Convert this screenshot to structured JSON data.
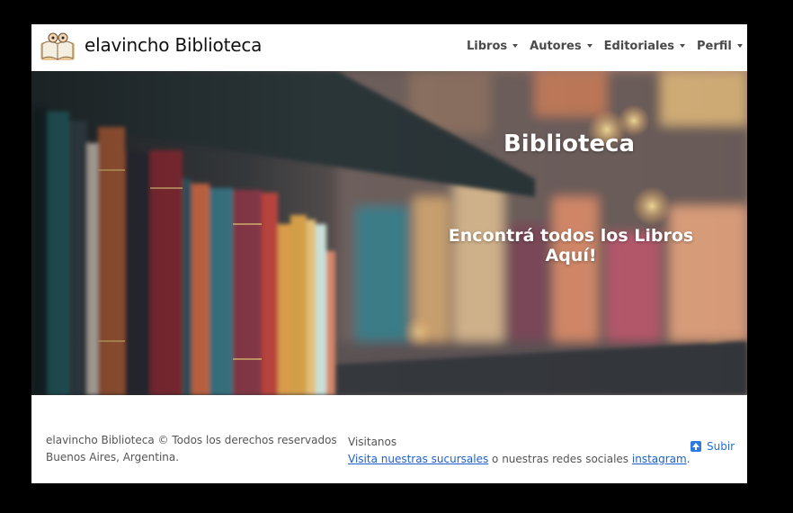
{
  "navbar": {
    "brand": "elavincho Biblioteca",
    "logo_icon": "open-book-logo-icon",
    "items": [
      {
        "label": "Libros"
      },
      {
        "label": "Autores"
      },
      {
        "label": "Editoriales"
      },
      {
        "label": "Perfil"
      }
    ]
  },
  "hero": {
    "title": "Biblioteca",
    "subtitle": "Encontrá todos los Libros Aquí!"
  },
  "footer": {
    "copyright": "elavincho Biblioteca © Todos los derechos reservados",
    "location": "Buenos Aires, Argentina.",
    "visit_heading": "Visitanos",
    "branches_link": "Visita nuestras sucursales",
    "social_text": " o nuestras redes sociales ",
    "instagram_link": "instagram",
    "period": ".",
    "up_label": "Subir",
    "up_icon": "arrow-up-icon"
  },
  "colors": {
    "link": "#1d5fd1",
    "nav_text": "#4a4a4a",
    "backdrop": "#000000"
  }
}
